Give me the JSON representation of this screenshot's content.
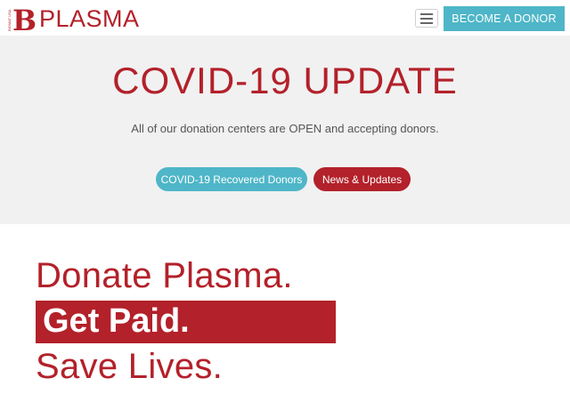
{
  "header": {
    "logo_text": "PLASMA",
    "logo_mark_letter": "B",
    "logo_mark_small": "BIOMAT USA",
    "menu_icon": "hamburger-menu-icon",
    "donor_button": "BECOME A DONOR"
  },
  "banner": {
    "title": "COVID-19 UPDATE",
    "subtitle": "All of our donation centers are OPEN and accepting donors.",
    "recovered_button": "COVID-19 Recovered Donors",
    "news_button": "News & Updates"
  },
  "hero": {
    "line1": "Donate Plasma.",
    "line2": "Get Paid.",
    "line3": "Save Lives."
  },
  "colors": {
    "brand_red": "#b3212a",
    "accent_teal": "#4eb6c8",
    "banner_bg": "#f1f1f1"
  }
}
